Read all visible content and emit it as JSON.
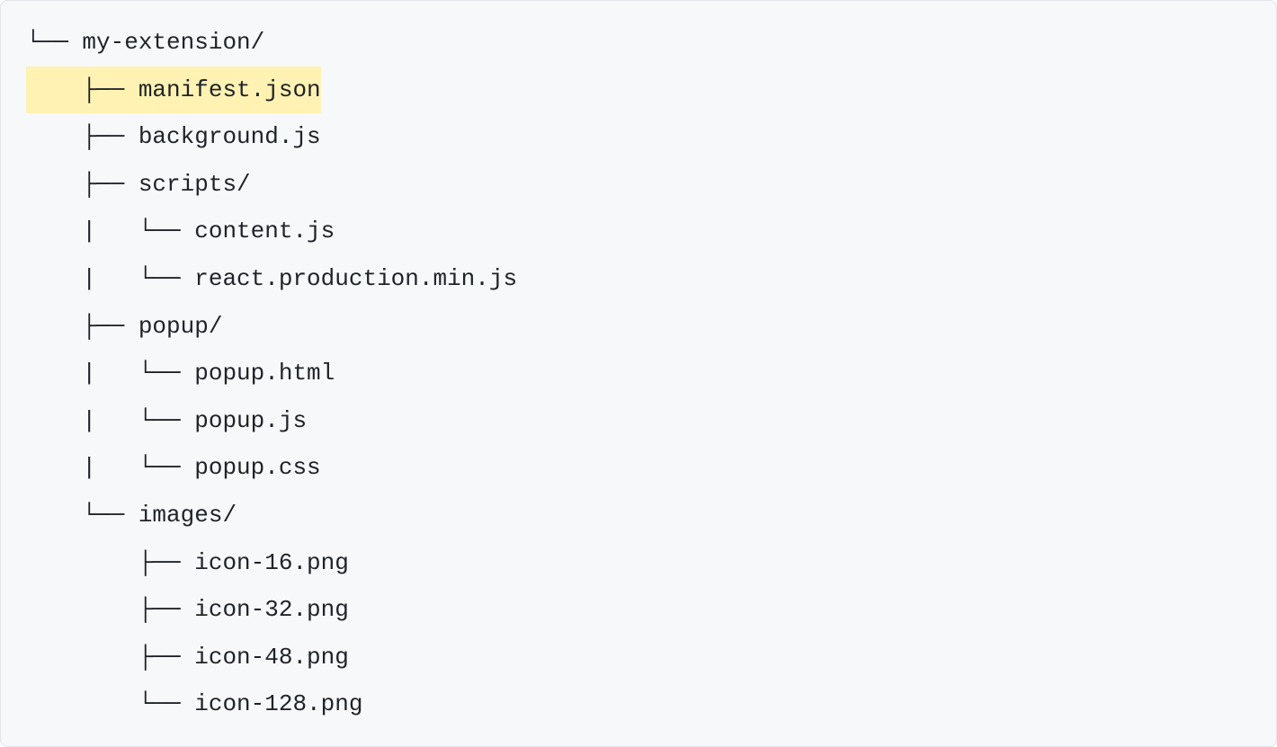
{
  "tree": {
    "lines": [
      {
        "prefix": "└── ",
        "name": "my-extension/",
        "highlighted": false
      },
      {
        "prefix": "    ├── ",
        "name": "manifest.json",
        "highlighted": true
      },
      {
        "prefix": "    ├── ",
        "name": "background.js",
        "highlighted": false
      },
      {
        "prefix": "    ├── ",
        "name": "scripts/",
        "highlighted": false
      },
      {
        "prefix": "    |   └── ",
        "name": "content.js",
        "highlighted": false
      },
      {
        "prefix": "    |   └── ",
        "name": "react.production.min.js",
        "highlighted": false
      },
      {
        "prefix": "    ├── ",
        "name": "popup/",
        "highlighted": false
      },
      {
        "prefix": "    |   └── ",
        "name": "popup.html",
        "highlighted": false
      },
      {
        "prefix": "    |   └── ",
        "name": "popup.js",
        "highlighted": false
      },
      {
        "prefix": "    |   └── ",
        "name": "popup.css",
        "highlighted": false
      },
      {
        "prefix": "    └── ",
        "name": "images/",
        "highlighted": false
      },
      {
        "prefix": "        ├── ",
        "name": "icon-16.png",
        "highlighted": false
      },
      {
        "prefix": "        ├── ",
        "name": "icon-32.png",
        "highlighted": false
      },
      {
        "prefix": "        ├── ",
        "name": "icon-48.png",
        "highlighted": false
      },
      {
        "prefix": "        └── ",
        "name": "icon-128.png",
        "highlighted": false
      }
    ]
  },
  "colors": {
    "highlight": "#fff2b2",
    "background": "#f6f8fa",
    "border": "#e1e4e8",
    "text": "#1f2328"
  }
}
